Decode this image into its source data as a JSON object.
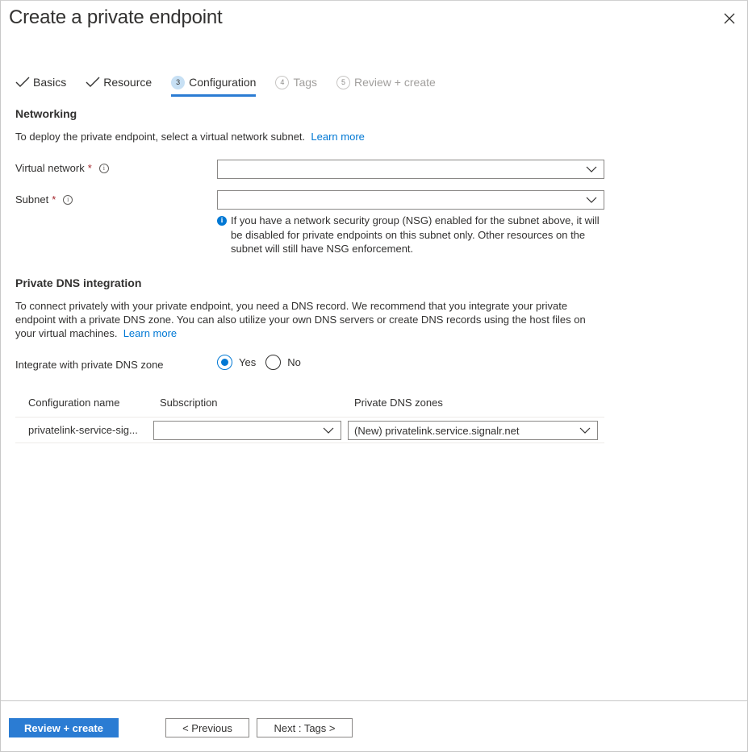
{
  "dialog": {
    "title": "Create a private endpoint",
    "close_icon": "close-icon"
  },
  "tabs": [
    {
      "label": "Basics",
      "state": "completed",
      "icon": "checkmark-icon"
    },
    {
      "label": "Resource",
      "state": "completed",
      "icon": "checkmark-icon"
    },
    {
      "label": "Configuration",
      "state": "active",
      "number": "3"
    },
    {
      "label": "Tags",
      "state": "disabled",
      "number": "4"
    },
    {
      "label": "Review + create",
      "state": "disabled",
      "number": "5"
    }
  ],
  "networking": {
    "heading": "Networking",
    "description": "To deploy the private endpoint, select a virtual network subnet.",
    "learn_more": "Learn more",
    "virtual_network": {
      "label": "Virtual network",
      "required_marker": "*",
      "value": ""
    },
    "subnet": {
      "label": "Subnet",
      "required_marker": "*",
      "value": ""
    },
    "nsg_note": "If you have a network security group (NSG) enabled for the subnet above, it will be disabled for private endpoints on this subnet only. Other resources on the subnet will still have NSG enforcement."
  },
  "dns": {
    "heading": "Private DNS integration",
    "description": "To connect privately with your private endpoint, you need a DNS record. We recommend that you integrate your private endpoint with a private DNS zone. You can also utilize your own DNS servers or create DNS records using the host files on your virtual machines.",
    "learn_more": "Learn more",
    "integrate_label": "Integrate with private DNS zone",
    "options": [
      {
        "label": "Yes",
        "checked": true
      },
      {
        "label": "No",
        "checked": false
      }
    ],
    "table": {
      "headers": [
        "Configuration name",
        "Subscription",
        "Private DNS zones"
      ],
      "rows": [
        {
          "configuration_name": "privatelink-service-sig...",
          "subscription": "",
          "private_dns_zone": "(New) privatelink.service.signalr.net"
        }
      ]
    }
  },
  "footer": {
    "review_create": "Review + create",
    "previous": "< Previous",
    "next": "Next : Tags >"
  },
  "colors": {
    "accent": "#2b7cd3",
    "link": "#0078d4",
    "required": "#a4262c"
  }
}
